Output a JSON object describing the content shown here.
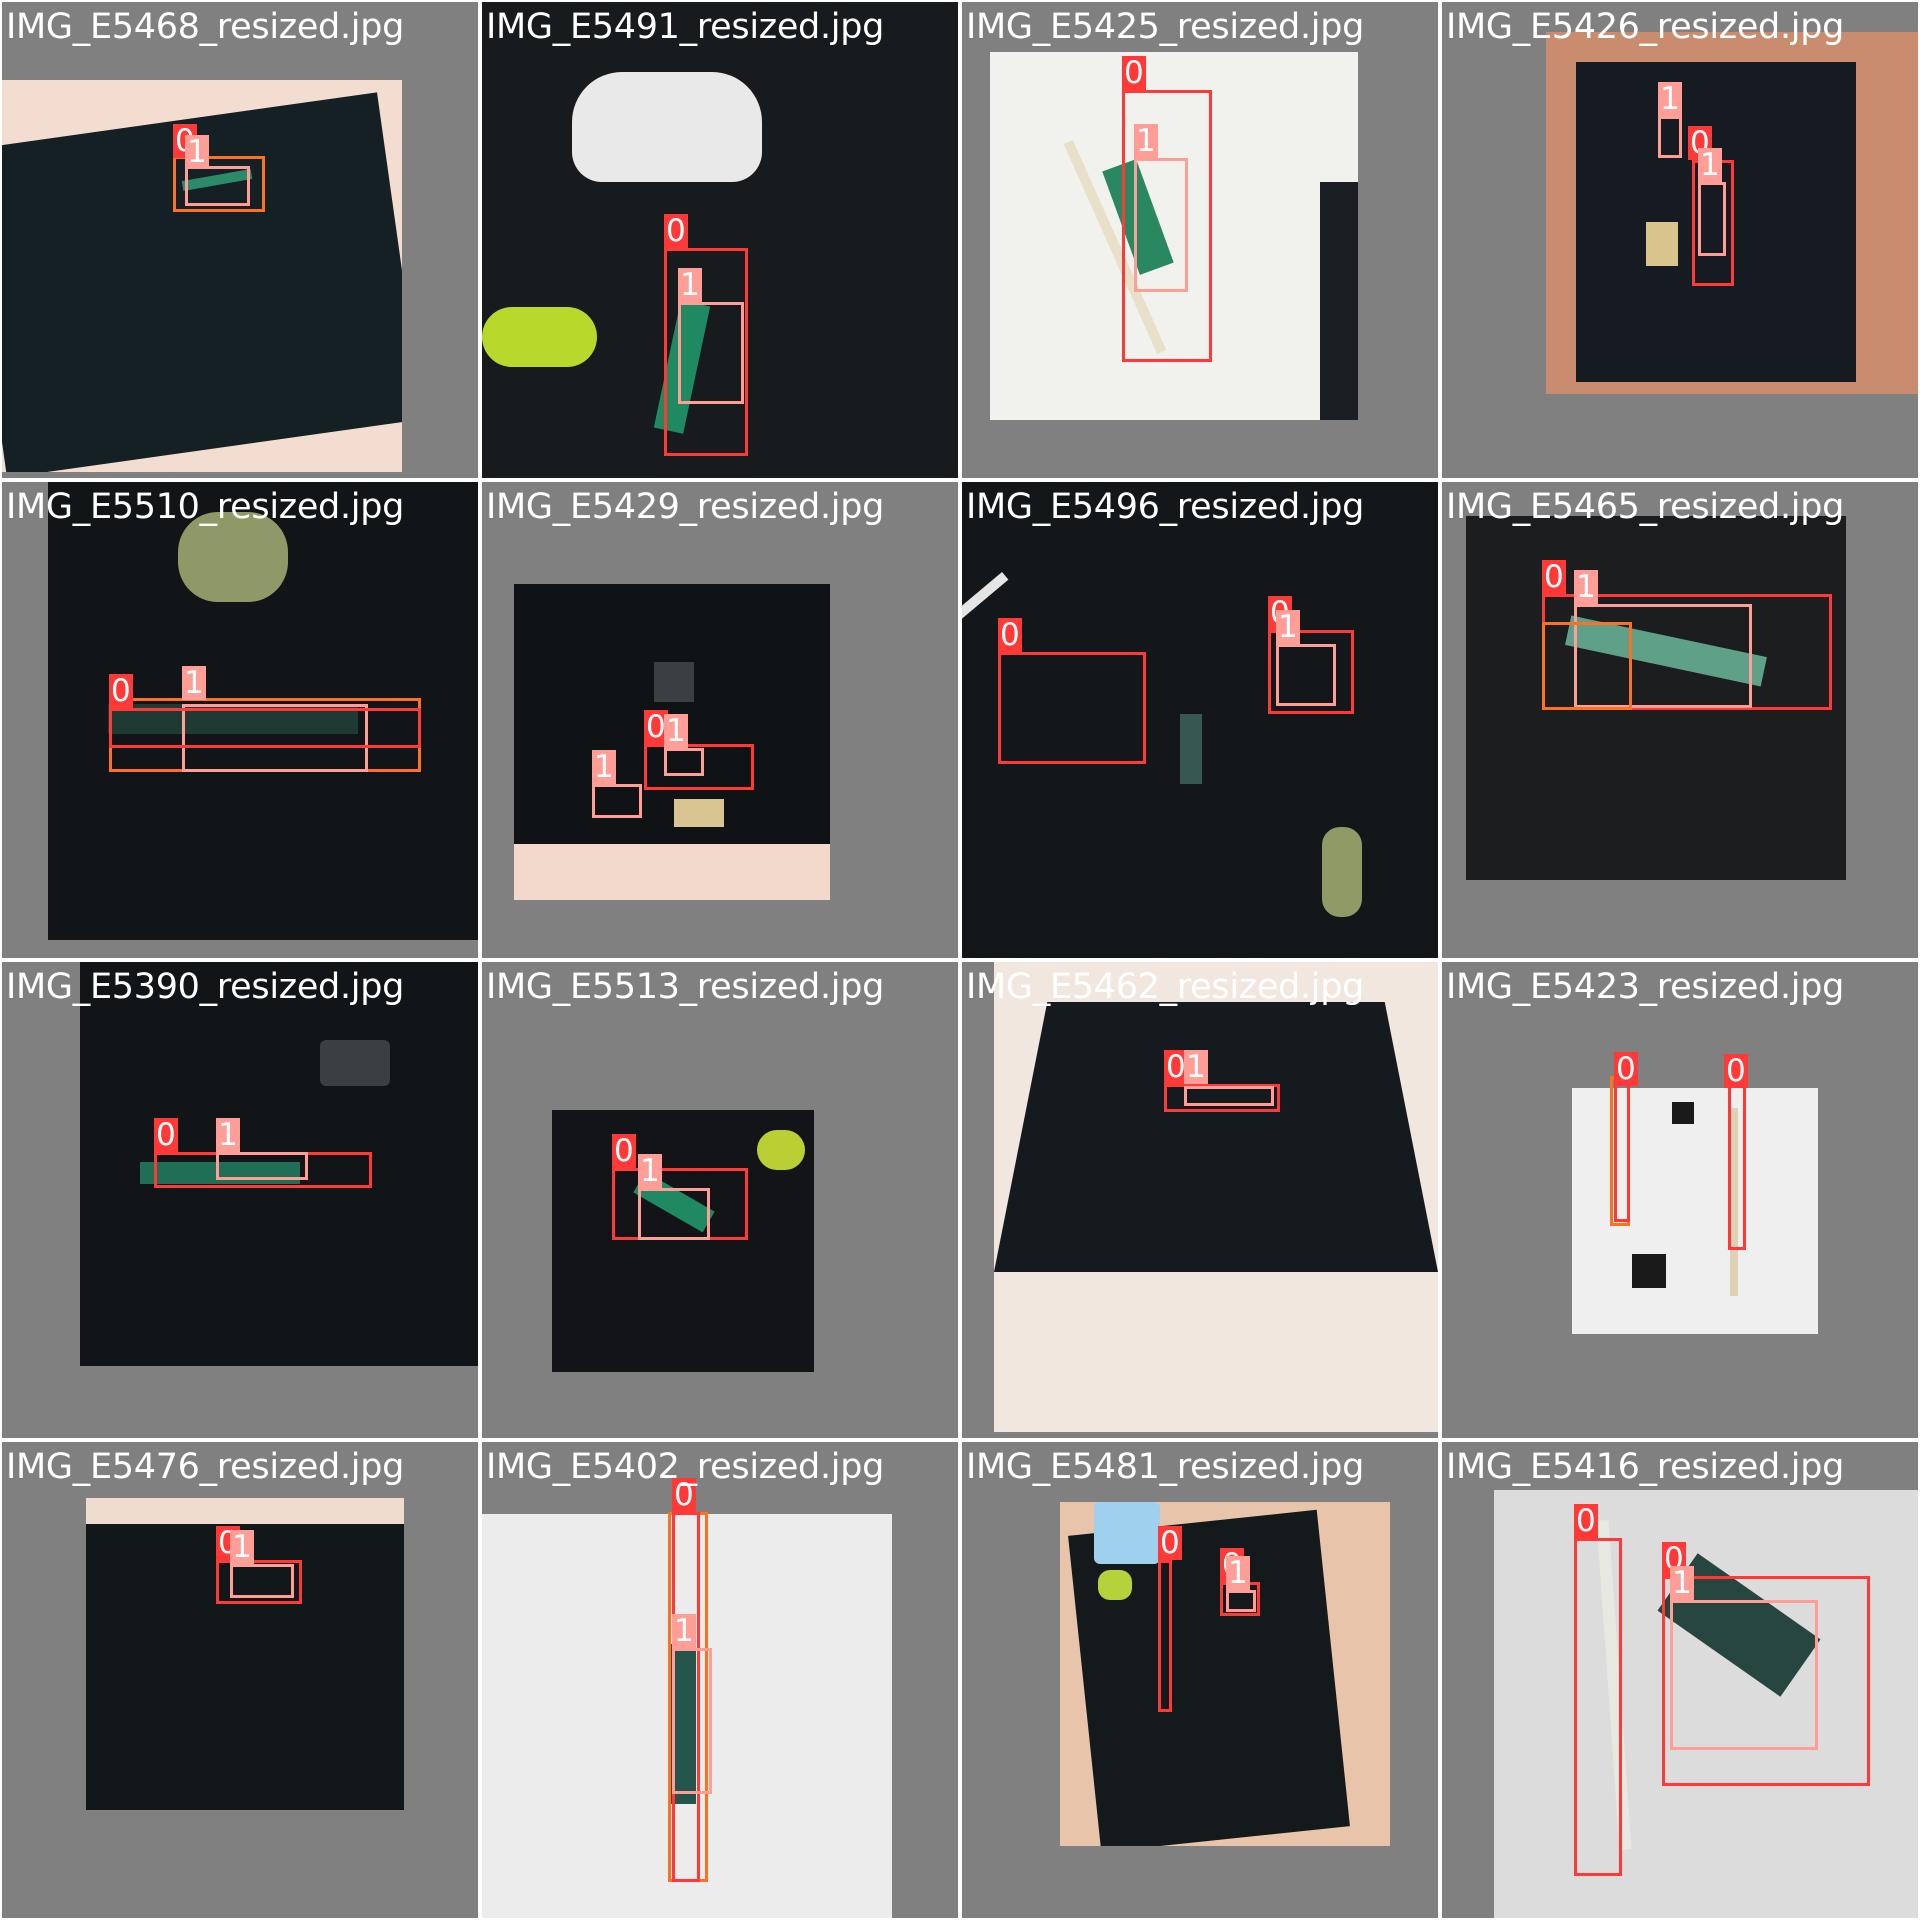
{
  "colors": {
    "tile_bg": "#808080",
    "class_0": "#ff3838",
    "class_1": "#ff9d97",
    "class_alt": "#ff701f",
    "felt": "#141c1f",
    "bed": "#f2dccd",
    "paper": "#f0f0f0",
    "pen_green": "#1f6f57",
    "pencil": "#e8e8e0"
  },
  "tiles": [
    {
      "label": "IMG_E5468_resized.jpg",
      "tags": [
        "0",
        "1"
      ]
    },
    {
      "label": "IMG_E5491_resized.jpg",
      "tags": [
        "0",
        "1"
      ]
    },
    {
      "label": "IMG_E5425_resized.jpg",
      "tags": [
        "0",
        "1"
      ]
    },
    {
      "label": "IMG_E5426_resized.jpg",
      "tags": [
        "1",
        "0",
        "1"
      ]
    },
    {
      "label": "IMG_E5510_resized.jpg",
      "tags": [
        "0",
        "1"
      ]
    },
    {
      "label": "IMG_E5429_resized.jpg",
      "tags": [
        "0",
        "1",
        "1"
      ]
    },
    {
      "label": "IMG_E5496_resized.jpg",
      "tags": [
        "0",
        "0",
        "1"
      ]
    },
    {
      "label": "IMG_E5465_resized.jpg",
      "tags": [
        "0",
        "1"
      ]
    },
    {
      "label": "IMG_E5390_resized.jpg",
      "tags": [
        "0",
        "1"
      ]
    },
    {
      "label": "IMG_E5513_resized.jpg",
      "tags": [
        "0",
        "1"
      ]
    },
    {
      "label": "IMG_E5462_resized.jpg",
      "tags": [
        "0",
        "1"
      ]
    },
    {
      "label": "IMG_E5423_resized.jpg",
      "tags": [
        "0",
        "0"
      ]
    },
    {
      "label": "IMG_E5476_resized.jpg",
      "tags": [
        "0",
        "1"
      ]
    },
    {
      "label": "IMG_E5402_resized.jpg",
      "tags": [
        "0",
        "1"
      ]
    },
    {
      "label": "IMG_E5481_resized.jpg",
      "tags": [
        "0",
        "0",
        "1"
      ]
    },
    {
      "label": "IMG_E5416_resized.jpg",
      "tags": [
        "0",
        "0",
        "1"
      ]
    }
  ]
}
